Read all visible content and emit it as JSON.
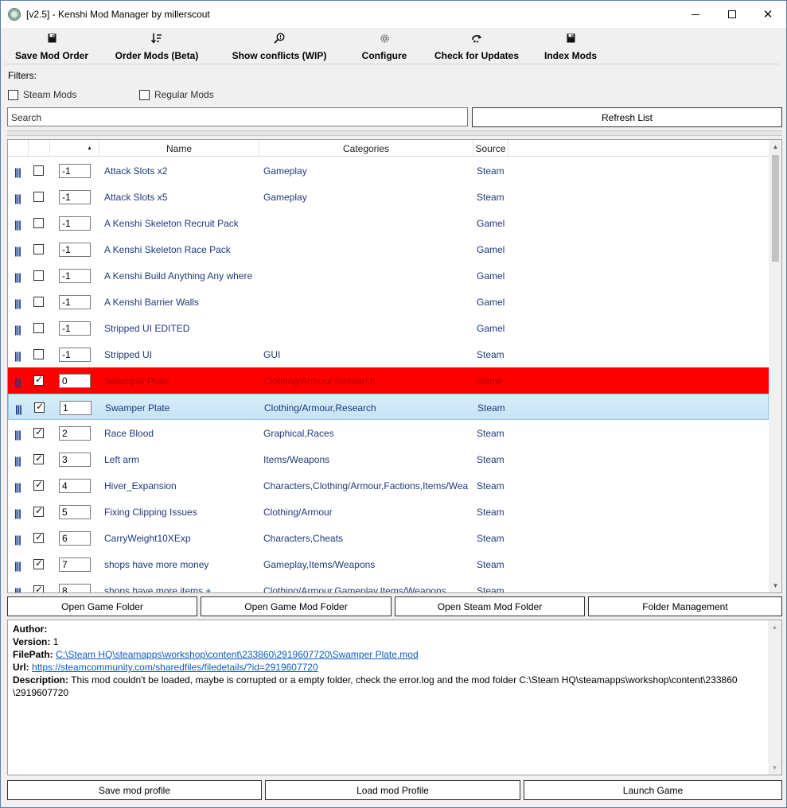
{
  "window": {
    "title": "[v2.5] - Kenshi Mod Manager by millerscout",
    "minimize_glyph": "—",
    "maximize_glyph": "☐",
    "close_glyph": "✕"
  },
  "toolbar": {
    "save_mod_order": "Save Mod Order",
    "order_mods": "Order Mods (Beta)",
    "show_conflicts": "Show conflicts (WIP)",
    "configure": "Configure",
    "check_updates": "Check for Updates",
    "index_mods": "Index Mods"
  },
  "filters": {
    "label": "Filters:",
    "steam_mods": "Steam Mods",
    "regular_mods": "Regular Mods"
  },
  "search": {
    "value": "Search"
  },
  "refresh_label": "Refresh List",
  "grid": {
    "columns": {
      "sort_glyph": "▲",
      "name": "Name",
      "categories": "Categories",
      "source": "Source"
    },
    "handle_glyph": "|||",
    "rows": [
      {
        "checked": false,
        "order": "-1",
        "name": "Attack Slots x2",
        "categories": "Gameplay",
        "source": "Steam",
        "state": ""
      },
      {
        "checked": false,
        "order": "-1",
        "name": "Attack Slots x5",
        "categories": "Gameplay",
        "source": "Steam",
        "state": ""
      },
      {
        "checked": false,
        "order": "-1",
        "name": "A Kenshi Skeleton Recruit Pack",
        "categories": "",
        "source": "Gamel",
        "state": ""
      },
      {
        "checked": false,
        "order": "-1",
        "name": "A Kenshi Skeleton Race Pack",
        "categories": "",
        "source": "Gamel",
        "state": ""
      },
      {
        "checked": false,
        "order": "-1",
        "name": "A Kenshi Build Anything Any where",
        "categories": "",
        "source": "Gamel",
        "state": ""
      },
      {
        "checked": false,
        "order": "-1",
        "name": "A Kenshi Barrier Walls",
        "categories": "",
        "source": "Gamel",
        "state": ""
      },
      {
        "checked": false,
        "order": "-1",
        "name": "Stripped UI EDITED",
        "categories": "",
        "source": "Gamel",
        "state": ""
      },
      {
        "checked": false,
        "order": "-1",
        "name": "Stripped UI",
        "categories": "GUI",
        "source": "Steam",
        "state": ""
      },
      {
        "checked": true,
        "order": "0",
        "name": "Swamper Plate",
        "categories": "Clothing/Armour,Research",
        "source": "Game",
        "state": "error"
      },
      {
        "checked": true,
        "order": "1",
        "name": "Swamper Plate",
        "categories": "Clothing/Armour,Research",
        "source": "Steam",
        "state": "selected"
      },
      {
        "checked": true,
        "order": "2",
        "name": "Race Blood",
        "categories": "Graphical,Races",
        "source": "Steam",
        "state": ""
      },
      {
        "checked": true,
        "order": "3",
        "name": "Left arm",
        "categories": "Items/Weapons",
        "source": "Steam",
        "state": ""
      },
      {
        "checked": true,
        "order": "4",
        "name": "Hiver_Expansion",
        "categories": "Characters,Clothing/Armour,Factions,Items/Weap",
        "source": "Steam",
        "state": ""
      },
      {
        "checked": true,
        "order": "5",
        "name": "Fixing Clipping Issues",
        "categories": "Clothing/Armour",
        "source": "Steam",
        "state": ""
      },
      {
        "checked": true,
        "order": "6",
        "name": "CarryWeight10XExp",
        "categories": "Characters,Cheats",
        "source": "Steam",
        "state": ""
      },
      {
        "checked": true,
        "order": "7",
        "name": "shops have more money",
        "categories": "Gameplay,Items/Weapons",
        "source": "Steam",
        "state": ""
      },
      {
        "checked": true,
        "order": "8",
        "name": "shops have more items +",
        "categories": "Clothing/Armour,Gameplay,Items/Weapons",
        "source": "Steam",
        "state": ""
      }
    ],
    "scroll_up": "▲",
    "scroll_down": "▼"
  },
  "folder_buttons": {
    "open_game_folder": "Open Game Folder",
    "open_game_mod_folder": "Open Game Mod Folder",
    "open_steam_mod_folder": "Open Steam Mod Folder",
    "folder_management": "Folder Management"
  },
  "details": {
    "author_label": "Author:",
    "author_value": "",
    "version_label": "Version:",
    "version_value": "1",
    "filepath_label": "FilePath:",
    "filepath_value": "C:\\Steam HQ\\steamapps\\workshop\\content\\233860\\2919607720\\Swamper Plate.mod",
    "url_label": "Url:",
    "url_value": "https://steamcommunity.com/sharedfiles/filedetails/?id=2919607720",
    "description_label": "Description:",
    "description_value": "This mod couldn't be loaded, maybe is corrupted or a empty folder, check the error.log and the mod folder C:\\Steam HQ\\steamapps\\workshop\\content\\233860",
    "description_value_cont": "\\2919607720"
  },
  "bottom_buttons": {
    "save_profile": "Save mod profile",
    "load_profile": "Load mod Profile",
    "launch_game": "Launch Game"
  }
}
